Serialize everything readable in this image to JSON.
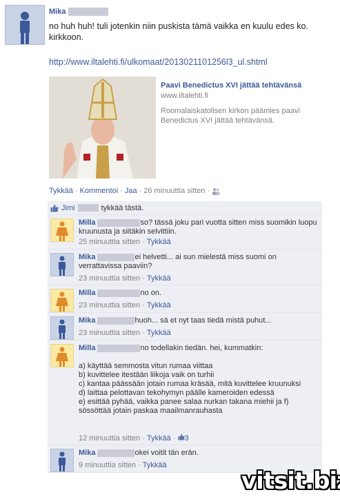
{
  "post": {
    "author": "Mika",
    "text": "no huh huh! tuli jotenkin niin puskista tämä vaikka en kuulu edes ko. kirkkoon.",
    "url": "http://www.iltalehti.fi/ulkomaat/2013021101256l3_ul.shtml",
    "share": {
      "title": "Paavi Benedictus XVI jättää tehtävänsä",
      "domain": "www.iltalehti.fi",
      "description": "Roomalaiskatolisen kirkon päämies paavi Benedictus XVI jättää tehtävänsä."
    },
    "actions": {
      "like": "Tykkää",
      "comment": "Kommentoi",
      "share": "Jaa",
      "time": "26 minuuttia sitten",
      "sep": "·"
    }
  },
  "likes": {
    "name": "Jimi",
    "text": "tykkää tästä."
  },
  "comments": [
    {
      "author": "Milla",
      "gender": "female",
      "text": "so? tässä joku pari vuotta sitten miss suomikin luopu kruunusta ja siitäkin selvittiin.",
      "time": "25 minuuttia sitten",
      "like": "Tykkää"
    },
    {
      "author": "Mika",
      "gender": "male",
      "text": "ei helvetti... ai sun mielestä miss suomi on verrattavissa paaviin?",
      "time": "23 minuuttia sitten",
      "like": "Tykkää"
    },
    {
      "author": "Milla",
      "gender": "female",
      "text": "no on.",
      "time": "23 minuuttia sitten",
      "like": "Tykkää"
    },
    {
      "author": "Mika",
      "gender": "male",
      "text": "huoh... sä et nyt taas tiedä mistä puhut...",
      "time": "23 minuuttia sitten",
      "like": "Tykkää"
    },
    {
      "author": "Milla",
      "gender": "female",
      "text": "no todellakin tiedän. hei, kummatkin:",
      "lines": [
        "",
        "a) käyttää semmosta vitun rumaa viittaa",
        "b) kuvittelee itestään liikoja vaik on turhii",
        "c) kantaa päässään jotain rumaa kräsää, mitä kuvittelee kruunuksi",
        "d) laittaa pelottavan tekohymyn päälle kameroiden edessä",
        "e) esittää pyhää, vaikka panee salaa nurkan takana miehii ja f) sössöttää jotain paskaa maailmanrauhasta"
      ],
      "time": "12 minuuttia sitten",
      "like": "Tykkää",
      "likes_count": "3"
    },
    {
      "author": "Mika",
      "gender": "male",
      "text": "okei voitit tän erän.",
      "time": "9 minuuttia sitten",
      "like": "Tykkää"
    }
  ],
  "watermark": "vitsit.biz"
}
